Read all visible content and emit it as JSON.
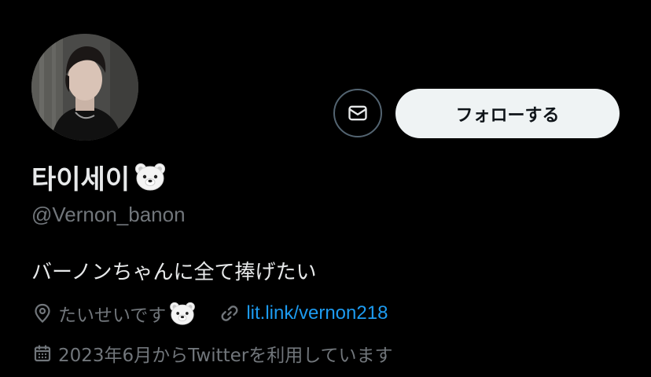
{
  "profile": {
    "display_name": "타이세이",
    "handle": "@Vernon_banon",
    "bio": "バーノンちゃんに全て捧げたい"
  },
  "actions": {
    "follow_label": "フォローする"
  },
  "meta": {
    "location": "たいせいです",
    "link": "lit.link/vernon218",
    "joined": "2023年6月からTwitterを利用しています"
  },
  "icons": {
    "message": "mail-icon",
    "location": "location-pin-icon",
    "link": "link-icon",
    "joined": "calendar-icon",
    "emoji": "polar-bear-face-emoji"
  },
  "colors": {
    "background": "#000000",
    "text_primary": "#e7e9ea",
    "text_secondary": "#71767b",
    "link": "#1d9bf0",
    "follow_button_bg": "#eff3f4"
  }
}
